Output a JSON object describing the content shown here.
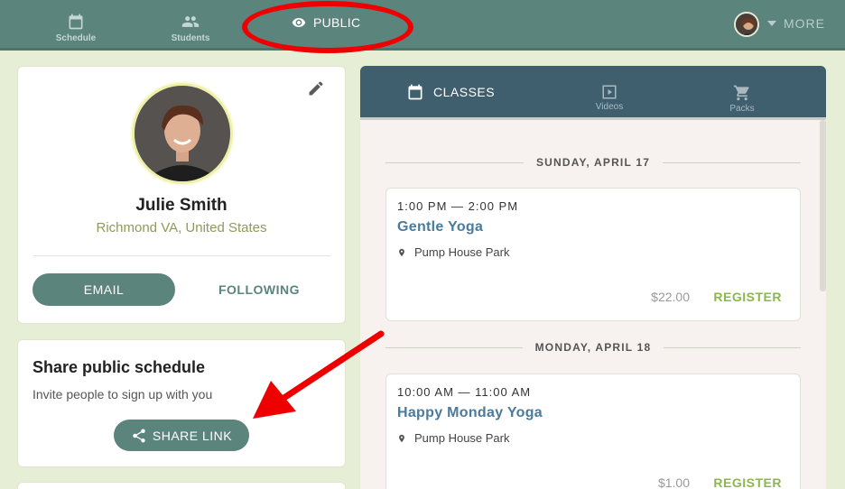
{
  "colors": {
    "topbar": "#5a847c",
    "primary_button": "#5a847c",
    "tabs_bar": "#3f5f6f",
    "link_blue": "#4a7a9c",
    "register_green": "#8bb84a",
    "location_olive": "#8f9a5a",
    "annotation_red": "#ee0000",
    "page_background": "#e6efd6"
  },
  "topnav": {
    "schedule_label": "Schedule",
    "students_label": "Students",
    "public_label": "PUBLIC",
    "more_label": "MORE",
    "icons": [
      "calendar-icon",
      "people-icon",
      "eye-icon",
      "caret-down-icon"
    ]
  },
  "profile": {
    "name": "Julie Smith",
    "location": "Richmond VA, United States",
    "email_label": "EMAIL",
    "following_label": "FOLLOWING"
  },
  "share": {
    "title": "Share public schedule",
    "subtitle": "Invite people to sign up with you",
    "button_label": "SHARE LINK"
  },
  "tabs": {
    "classes": "CLASSES",
    "videos": "Videos",
    "packs": "Packs"
  },
  "schedule": {
    "days": [
      {
        "date": "SUNDAY, APRIL 17",
        "classes": [
          {
            "time": "1:00 PM — 2:00 PM",
            "name": "Gentle Yoga",
            "location": "Pump House Park",
            "price": "$22.00",
            "action": "REGISTER"
          }
        ]
      },
      {
        "date": "MONDAY, APRIL 18",
        "classes": [
          {
            "time": "10:00 AM — 11:00 AM",
            "name": "Happy Monday Yoga",
            "location": "Pump House Park",
            "price": "$1.00",
            "action": "REGISTER"
          }
        ]
      }
    ]
  }
}
